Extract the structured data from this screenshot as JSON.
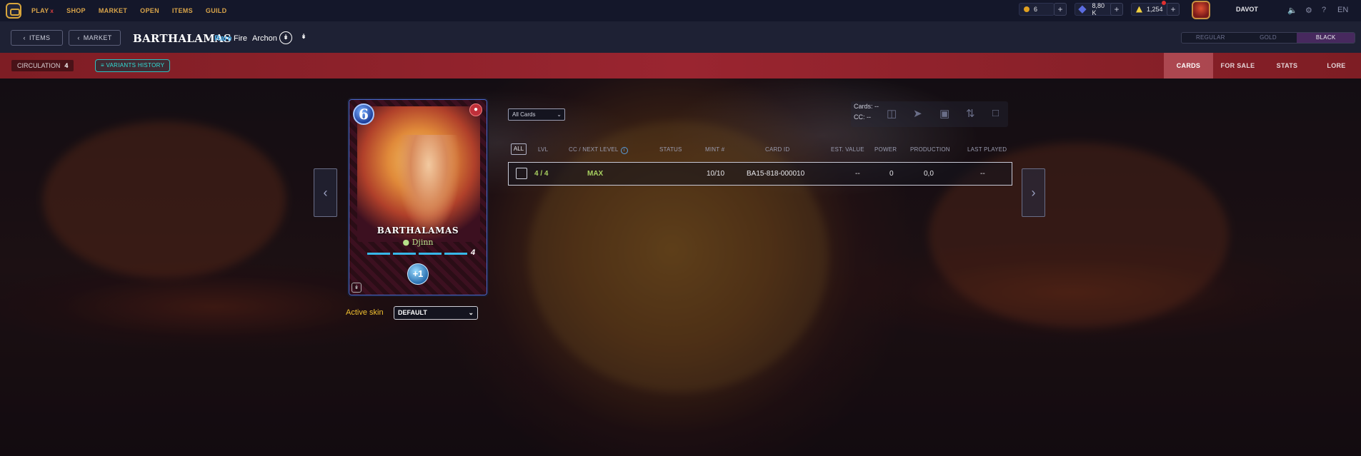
{
  "topnav": {
    "links": [
      "PLAY",
      "SHOP",
      "MARKET",
      "OPEN",
      "ITEMS",
      "GUILD"
    ],
    "play_badge": "x",
    "dec_amount": "6",
    "sps_amount": "8,80 K",
    "vouchers_amount": "1,254",
    "username": "DAVOT",
    "language": "EN"
  },
  "header": {
    "items_button": "ITEMS",
    "market_button": "MARKET",
    "card_name": "BARTHALAMAS",
    "rarity": "Rare",
    "element": "Fire",
    "edition": "Archon",
    "variants": [
      "REGULAR",
      "GOLD",
      "BLACK"
    ],
    "active_variant": "BLACK"
  },
  "band": {
    "circulation_label": "CIRCULATION",
    "circulation_value": "4",
    "variants_history": "VARIANTS HISTORY",
    "tabs": [
      "CARDS",
      "FOR SALE",
      "STATS",
      "LORE"
    ],
    "active_tab": "CARDS"
  },
  "card": {
    "mana": "6",
    "name": "BARTHALAMAS",
    "type": "Djinn",
    "level": "4",
    "ability": "+1"
  },
  "skin": {
    "label": "Active skin",
    "value": "DEFAULT"
  },
  "filter": {
    "value": "All Cards"
  },
  "summary": {
    "cards_label": "Cards: --",
    "cc_label": "CC: --"
  },
  "table": {
    "headers": [
      "ALL",
      "LVL",
      "CC / NEXT LEVEL",
      "STATUS",
      "MINT #",
      "CARD ID",
      "EST. VALUE",
      "POWER",
      "PRODUCTION",
      "LAST PLAYED"
    ],
    "rows": [
      {
        "lvl": "4 / 4",
        "cc": "MAX",
        "status": "",
        "mint": "10/10",
        "card_id": "BA15-818-000010",
        "est_value": "--",
        "power": "0",
        "production": "0,0",
        "last_played": "--"
      }
    ]
  },
  "colors": {
    "accent_gold": "#d9a44a",
    "band_red": "#9a2530",
    "active_variant": "#47295e",
    "rarity_blue": "#4fb4f0",
    "teal": "#2fe0d8"
  },
  "icons": [
    "logo-icon",
    "chevron-left-icon",
    "edition-icon",
    "dec-coin-icon",
    "sps-icon",
    "voucher-icon",
    "volume-icon",
    "settings-icon",
    "help-icon",
    "add-icon",
    "gift-icon",
    "send-icon",
    "market-icon",
    "transfer-icon",
    "lock-icon",
    "info-icon",
    "list-icon"
  ]
}
